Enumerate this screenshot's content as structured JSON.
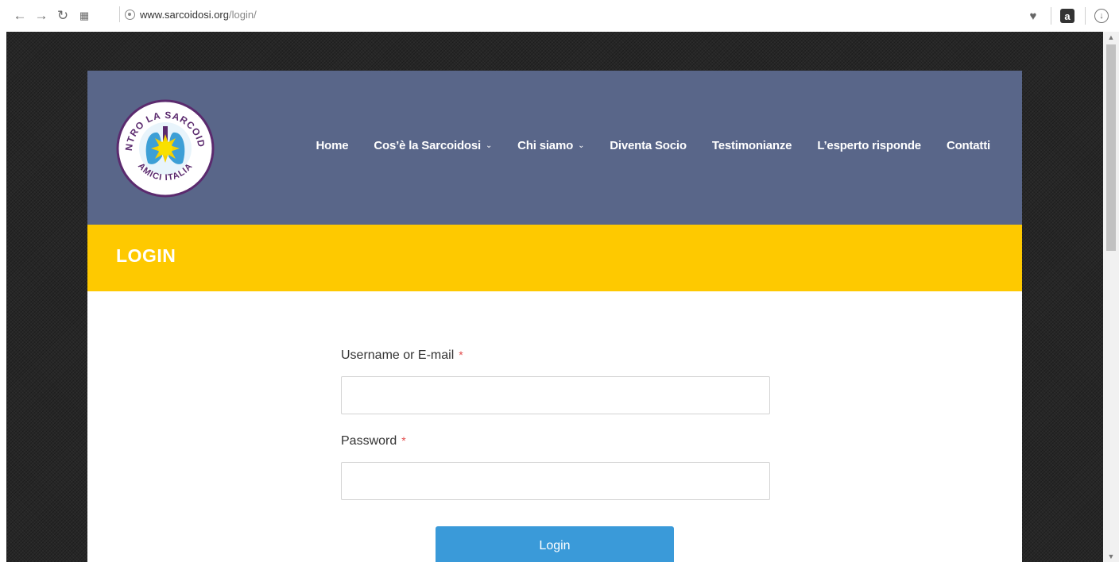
{
  "browser": {
    "url_host": "www.sarcoidosi.org",
    "url_path": "/login/",
    "amazon_ext_label": "a"
  },
  "logo": {
    "text_top": "CONTRO LA SARCOIDOSI",
    "text_bottom": "AMICI ITALIA"
  },
  "nav": {
    "items": [
      {
        "label": "Home",
        "has_dropdown": false
      },
      {
        "label": "Cos’è la Sarcoidosi",
        "has_dropdown": true
      },
      {
        "label": "Chi siamo",
        "has_dropdown": true
      },
      {
        "label": "Diventa Socio",
        "has_dropdown": false
      },
      {
        "label": "Testimonianze",
        "has_dropdown": false
      },
      {
        "label": "L’esperto risponde",
        "has_dropdown": false
      },
      {
        "label": "Contatti",
        "has_dropdown": false
      }
    ]
  },
  "page": {
    "title": "LOGIN"
  },
  "form": {
    "username_label": "Username or E-mail",
    "username_value": "",
    "password_label": "Password",
    "password_value": "",
    "required_mark": "*",
    "submit_label": "Login"
  },
  "colors": {
    "header_bg": "#596689",
    "title_bar_bg": "#fec900",
    "button_bg": "#3a9ad9",
    "required": "#e24a4a"
  }
}
